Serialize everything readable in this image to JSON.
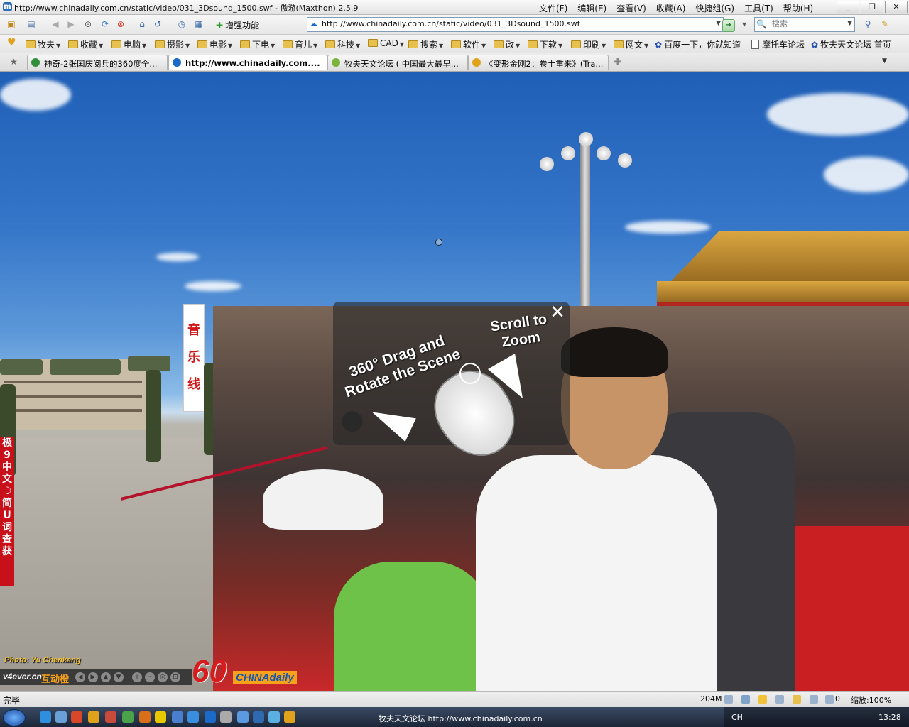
{
  "window": {
    "title": "http://www.chinadaily.com.cn/static/video/031_3Dsound_1500.swf - 傲游(Maxthon) 2.5.9",
    "menu": [
      "文件(F)",
      "编辑(E)",
      "查看(V)",
      "收藏(A)",
      "快捷组(G)",
      "工具(T)",
      "帮助(H)"
    ],
    "controls": [
      "_",
      "❐",
      "✕"
    ]
  },
  "toolbar": {
    "enhance_label": "增强功能",
    "address": "http://www.chinadaily.com.cn/static/video/031_3Dsound_1500.swf",
    "search_placeholder": "搜索",
    "icons": [
      "new-page-icon",
      "open-icon",
      "back-icon",
      "forward-icon",
      "stop-icon",
      "refresh-icon",
      "home-icon",
      "undo-icon",
      "history-icon",
      "screenshot-icon"
    ]
  },
  "bookmarks": [
    {
      "label": "牧夫",
      "type": "folder"
    },
    {
      "label": "收藏",
      "type": "folder"
    },
    {
      "label": "电脑",
      "type": "folder"
    },
    {
      "label": "摄影",
      "type": "folder"
    },
    {
      "label": "电影",
      "type": "folder"
    },
    {
      "label": "下电",
      "type": "folder"
    },
    {
      "label": "育儿",
      "type": "folder"
    },
    {
      "label": "科技",
      "type": "folder"
    },
    {
      "label": "CAD",
      "type": "folder"
    },
    {
      "label": "搜索",
      "type": "folder"
    },
    {
      "label": "软件",
      "type": "folder"
    },
    {
      "label": "政",
      "type": "folder"
    },
    {
      "label": "下软",
      "type": "folder"
    },
    {
      "label": "印刷",
      "type": "folder"
    },
    {
      "label": "网文",
      "type": "folder"
    },
    {
      "label": "百度一下，你就知道",
      "type": "link"
    },
    {
      "label": "摩托车论坛",
      "type": "link"
    },
    {
      "label": "牧夫天文论坛 首页",
      "type": "link"
    }
  ],
  "tabs": [
    {
      "label": "神奇-2张国庆阅兵的360度全...",
      "active": false,
      "color": "#2f8f3a"
    },
    {
      "label": "http://www.chinadaily.com....",
      "active": true,
      "color": "#1b6ac9"
    },
    {
      "label": "牧夫天文论坛 ( 中国最大最早...",
      "active": false,
      "color": "#7bb33c"
    },
    {
      "label": "《变形金刚2：卷土重来》(Tra...",
      "active": false,
      "color": "#e0a21a"
    }
  ],
  "overlay": {
    "drag_text": "360° Drag and Rotate the Scene",
    "scroll_text": "Scroll to Zoom",
    "close": "✕"
  },
  "scene": {
    "banner_chars": [
      "音",
      "乐",
      "线"
    ],
    "side_band": [
      "极",
      "9",
      "中",
      "文",
      "☽",
      "简",
      "U",
      "词",
      "查",
      "获"
    ]
  },
  "player": {
    "credit": "Photo: Yu Chenkang",
    "site": "v4ever.cn",
    "site_label": "互动橙",
    "logo_number": "60",
    "logo_brand": "CHINAdaily",
    "controls": [
      "◀",
      "▶",
      "▲",
      "▼",
      "+",
      "−",
      "◎",
      "⊡"
    ]
  },
  "status": {
    "text": "完毕",
    "memory": "204M",
    "count": "0",
    "zoom": "缩放:100%"
  },
  "taskbar": {
    "task_text": "牧夫天文论坛   http://www.chinadaily.com.cn",
    "input_method": "CH",
    "clock": "13:28"
  }
}
